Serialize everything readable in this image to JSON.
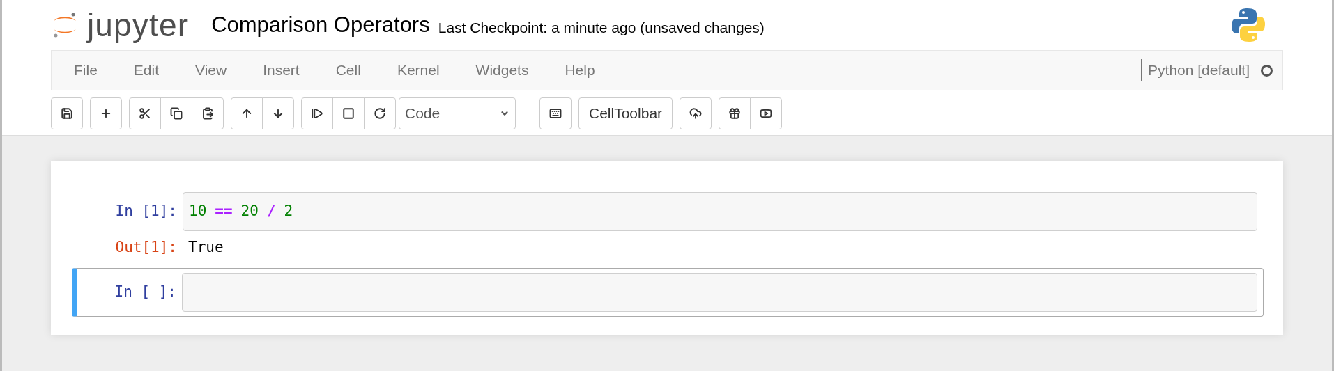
{
  "header": {
    "logo_text": "jupyter",
    "notebook_title": "Comparison Operators",
    "checkpoint": "Last Checkpoint: a minute ago (unsaved changes)"
  },
  "menu": [
    "File",
    "Edit",
    "View",
    "Insert",
    "Cell",
    "Kernel",
    "Widgets",
    "Help"
  ],
  "kernel": {
    "name": "Python [default]",
    "busy": false
  },
  "toolbar": {
    "cell_type": "Code",
    "celltoolbar_label": "CellToolbar"
  },
  "cells": [
    {
      "prompt": "In [1]:",
      "selected": false,
      "code": [
        {
          "kind": "number",
          "text": "10"
        },
        {
          "kind": "operator",
          "text": "=="
        },
        {
          "kind": "number",
          "text": "20"
        },
        {
          "kind": "operator",
          "text": "/"
        },
        {
          "kind": "number",
          "text": "2"
        }
      ],
      "output": {
        "prompt": "Out[1]:",
        "text": "True"
      }
    },
    {
      "prompt": "In [ ]:",
      "selected": true
    }
  ]
}
